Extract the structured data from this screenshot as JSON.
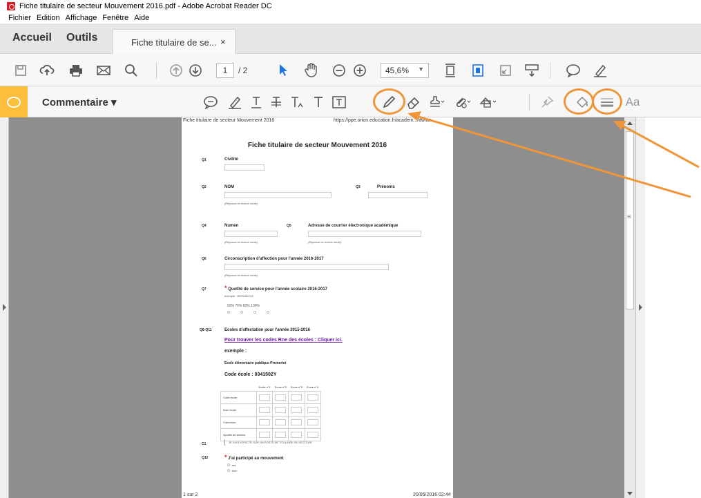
{
  "window": {
    "title": "Fiche titulaire de secteur Mouvement 2016.pdf - Adobe Acrobat Reader DC"
  },
  "menu": {
    "items": [
      "Fichier",
      "Edition",
      "Affichage",
      "Fenêtre",
      "Aide"
    ]
  },
  "tabs": {
    "home": "Accueil",
    "tools": "Outils",
    "document": "Fiche titulaire de se...",
    "close": "×"
  },
  "toolbar": {
    "page_current": "1",
    "page_total": "/ 2",
    "zoom": "45,6%"
  },
  "comment_bar": {
    "label": "Commentaire",
    "font_label": "Aa"
  },
  "colors": {
    "accent": "#f0963a",
    "comment_tag": "#fbbf3c",
    "required": "#d32f2f",
    "link": "#6a1b9a"
  },
  "document": {
    "header_left": "Fiche titulaire de secteur Mouvement 2016",
    "header_right": "https://ppe.orion.education.fr/academ.../itw/an...",
    "title": "Fiche titulaire de secteur Mouvement 2016",
    "q1": {
      "num": "Q1",
      "label": "Civilité"
    },
    "q2": {
      "num": "Q2",
      "label": "NOM",
      "hint": "(Réponse en lecture seule)"
    },
    "q3": {
      "num": "Q3",
      "label": "Prénoms"
    },
    "q4": {
      "num": "Q4",
      "label": "Numen",
      "hint": "(Réponse en lecture seule)"
    },
    "q5": {
      "num": "Q5",
      "label": "Adresse de courrier électronique académique",
      "hint": "(Réponse en lecture seule)"
    },
    "q6": {
      "num": "Q6",
      "label": "Circonscription d'affection pour l'année 2016-2017",
      "hint": "(Réponse en lecture seule)"
    },
    "q7": {
      "num": "Q7",
      "label": "Quotité de service pour l'année scolaire 2016-2017",
      "example": "exemple : 50/75/80/100",
      "options": "50%   75%   80%   100%"
    },
    "q8": {
      "num": "Q8-Q11",
      "label": "Ecoles d'affectation pour l'année 2015-2016",
      "link": "Pour trouver les codes Rne des écoles : Cliquer ici.",
      "example_title": "exemple :",
      "example_school": "École élémentaire publique Premerlet",
      "example_code": "Code école : 0341502Y"
    },
    "table": {
      "headers": [
        "",
        "Ecole n°1",
        "Ecole n°2",
        "Ecole n°3",
        "Ecole n°4"
      ],
      "rows": [
        "Code école",
        "Nom école",
        "Commune",
        "Quotité de service"
      ]
    },
    "c1": {
      "num": "C1",
      "label": "JE SUIS AFFECTE SUR UN POSTE DE TITULAIRE DE SECTEUR"
    },
    "q12": {
      "num": "Q12",
      "label": "J'ai participé au mouvement",
      "opt1": "oui",
      "opt2": "non"
    },
    "footer_left": "1 sur 2",
    "footer_right": "20/05/2016 02:44"
  }
}
